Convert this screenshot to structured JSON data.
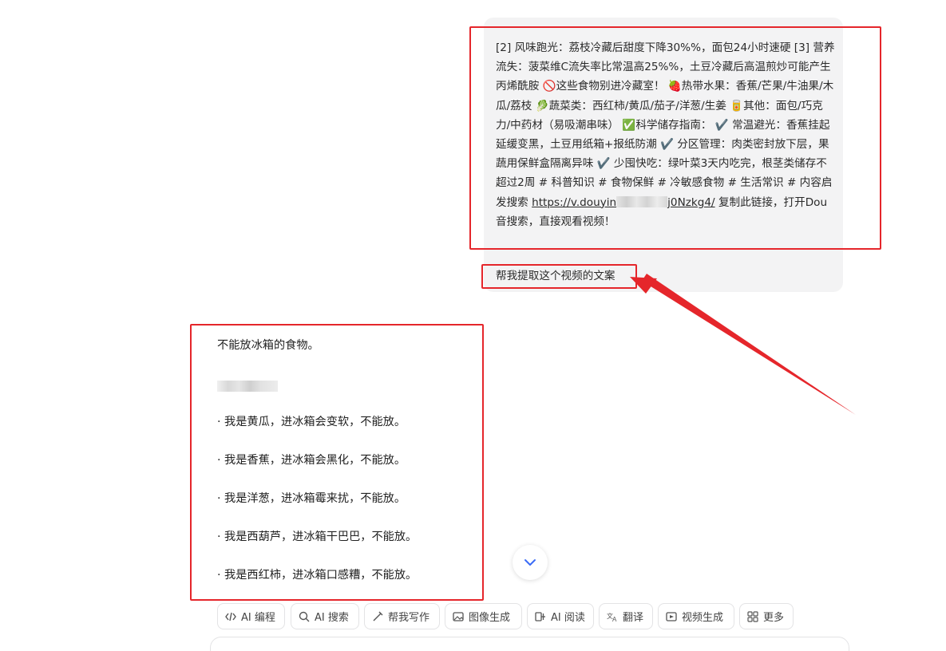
{
  "user_message": {
    "text_before_link": "[2] 风味跑光：荔枝冷藏后甜度下降30%%，面包24小时速硬 [3] 营养流失：菠菜维C流失率比常温高25%%，土豆冷藏后高温煎炒可能产生丙烯酰胺 🚫这些食物别进冷藏室！ 🍓热带水果：香蕉/芒果/牛油果/木瓜/荔枝 🥬蔬菜类：西红柿/黄瓜/茄子/洋葱/生姜 🥫其他：面包/巧克力/中药材（易吸潮串味） ✅科学储存指南： ✔️ 常温避光：香蕉挂起延缓变黑，土豆用纸箱+报纸防潮 ✔️ 分区管理：肉类密封放下层，果蔬用保鲜盒隔离异味 ✔️ 少囤快吃：绿叶菜3天内吃完，根茎类储存不超过2周 # 科普知识 # 食物保鲜 # 冷敏感食物 # 生活常识 # 内容启发搜索 ",
    "link_start": "https://v.douyin",
    "link_end": "j0Nzkg4/",
    "text_after_link": " 复制此链接，打开Dou音搜索，直接观看视频！",
    "question": "帮我提取这个视频的文案"
  },
  "assistant_message": {
    "title": "不能放冰箱的食物。",
    "items": [
      "· 我是黄瓜，进冰箱会变软，不能放。",
      "· 我是香蕉，进冰箱会黑化，不能放。",
      "· 我是洋葱，进冰箱霉来扰，不能放。",
      "· 我是西葫芦，进冰箱干巴巴，不能放。",
      "· 我是西红柿，进冰箱口感糟，不能放。"
    ]
  },
  "toolbar": {
    "items": [
      {
        "label": "AI 编程",
        "icon": "code-icon"
      },
      {
        "label": "AI 搜索",
        "icon": "search-icon"
      },
      {
        "label": "帮我写作",
        "icon": "pen-icon"
      },
      {
        "label": "图像生成",
        "icon": "image-icon"
      },
      {
        "label": "AI 阅读",
        "icon": "read-icon"
      },
      {
        "label": "翻译",
        "icon": "translate-icon"
      },
      {
        "label": "视频生成",
        "icon": "video-icon"
      },
      {
        "label": "更多",
        "icon": "grid-icon"
      }
    ]
  },
  "scroll_button": {
    "icon": "chevron-down-icon"
  },
  "colors": {
    "annotation_red": "#e5262b",
    "bubble_bg": "#f3f3f4",
    "accent_blue": "#3b6cf6"
  }
}
